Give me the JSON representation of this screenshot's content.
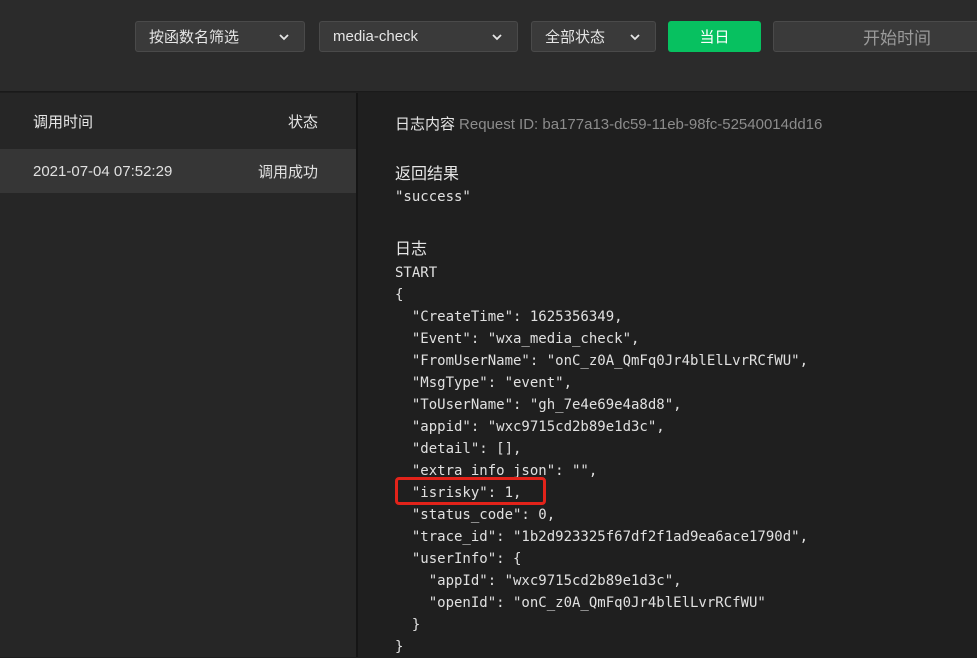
{
  "toolbar": {
    "function_filter": "按函数名筛选",
    "function_name": "media-check",
    "status_filter": "全部状态",
    "today_button": "当日",
    "start_time_placeholder": "开始时间",
    "accent_color": "#07c160"
  },
  "list": {
    "header_time": "调用时间",
    "header_status": "状态",
    "rows": [
      {
        "time": "2021-07-04 07:52:29",
        "status": "调用成功"
      }
    ]
  },
  "detail": {
    "log_content_label": "日志内容",
    "request_id": "Request ID: ba177a13-dc59-11eb-98fc-52540014dd16",
    "result_title": "返回结果",
    "result_value": "\"success\"",
    "log_title": "日志",
    "log_lines": [
      "START",
      "{",
      "  \"CreateTime\": 1625356349,",
      "  \"Event\": \"wxa_media_check\",",
      "  \"FromUserName\": \"onC_z0A_QmFq0Jr4blElLvrRCfWU\",",
      "  \"MsgType\": \"event\",",
      "  \"ToUserName\": \"gh_7e4e69e4a8d8\",",
      "  \"appid\": \"wxc9715cd2b89e1d3c\",",
      "  \"detail\": [],",
      "  \"extra_info_json\": \"\",",
      "  \"isrisky\": 1,",
      "  \"status_code\": 0,",
      "  \"trace_id\": \"1b2d923325f67df2f1ad9ea6ace1790d\",",
      "  \"userInfo\": {",
      "    \"appId\": \"wxc9715cd2b89e1d3c\",",
      "    \"openId\": \"onC_z0A_QmFq0Jr4blElLvrRCfWU\"",
      "  }",
      "}"
    ],
    "highlight_color": "#e2231a"
  }
}
